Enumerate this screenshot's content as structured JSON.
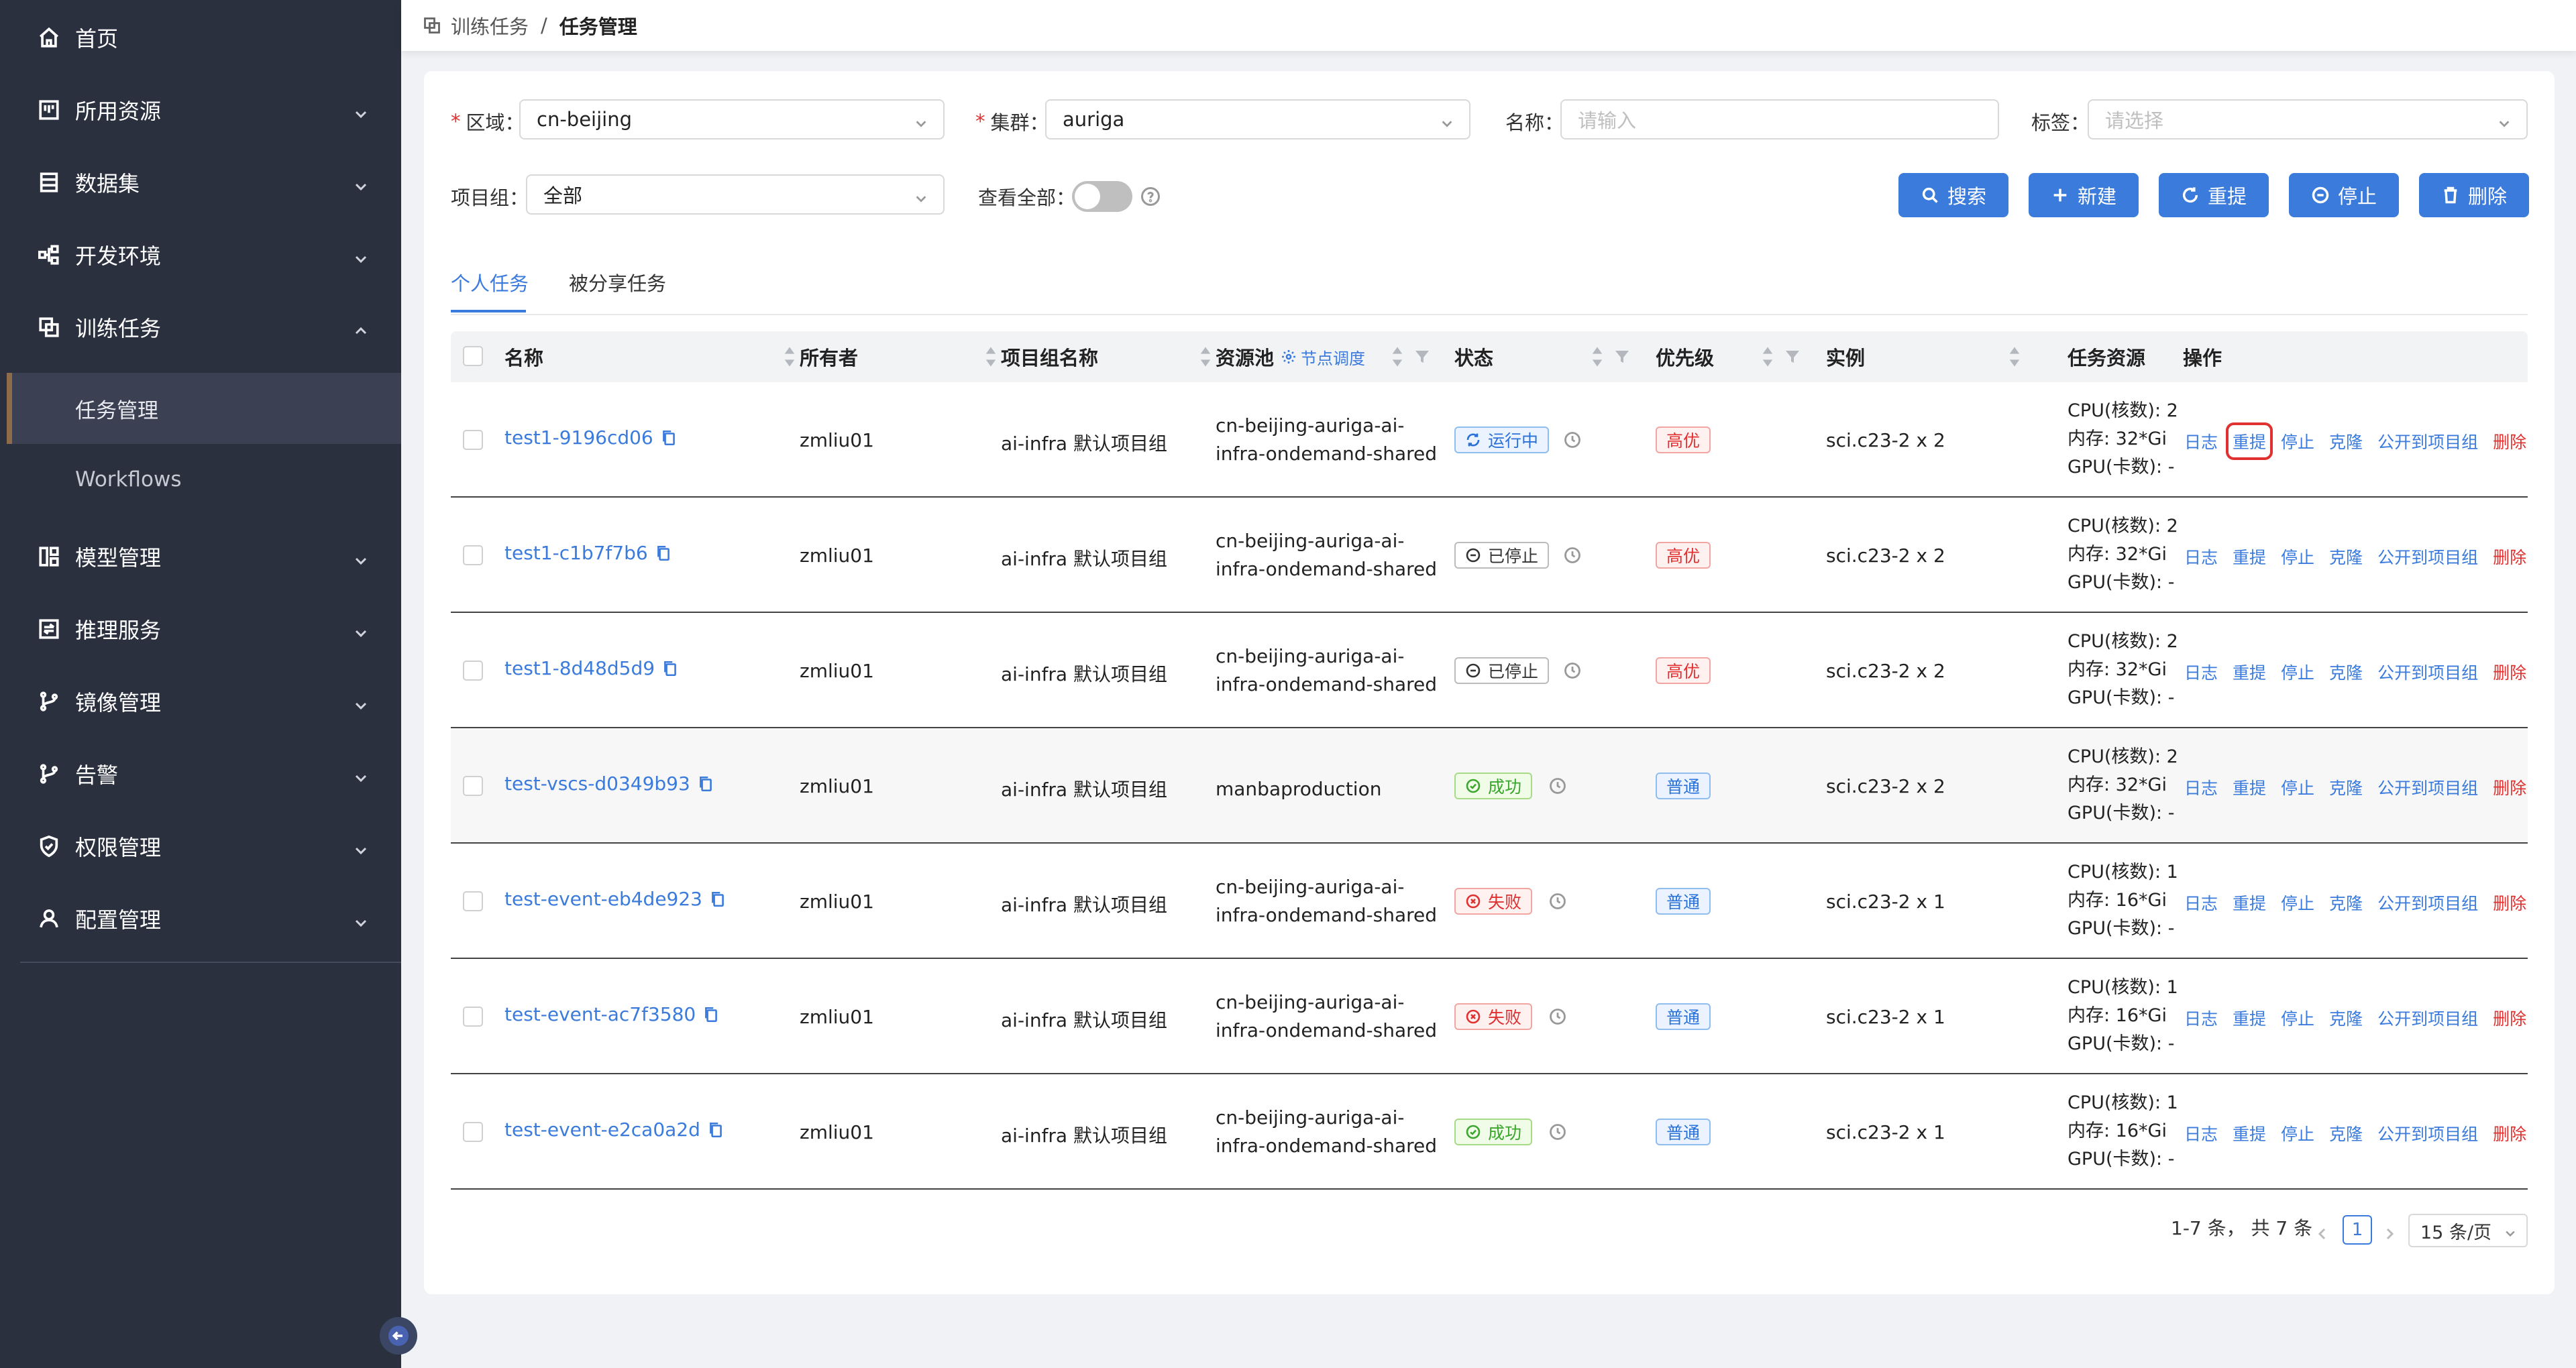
{
  "sidebar": {
    "items": [
      {
        "label": "首页",
        "icon": "home-icon"
      },
      {
        "label": "所用资源",
        "icon": "resource-icon"
      },
      {
        "label": "数据集",
        "icon": "dataset-icon"
      },
      {
        "label": "开发环境",
        "icon": "dev-env-icon"
      },
      {
        "label": "训练任务",
        "icon": "training-icon"
      },
      {
        "label": "模型管理",
        "icon": "model-icon"
      },
      {
        "label": "推理服务",
        "icon": "inference-icon"
      },
      {
        "label": "镜像管理",
        "icon": "image-icon"
      },
      {
        "label": "告警",
        "icon": "alert-icon"
      },
      {
        "label": "权限管理",
        "icon": "shield-icon"
      },
      {
        "label": "配置管理",
        "icon": "user-icon"
      }
    ],
    "submenu": [
      {
        "label": "任务管理"
      },
      {
        "label": "Workflows"
      }
    ]
  },
  "breadcrumb": {
    "parent": "训练任务",
    "sep": "/",
    "current": "任务管理"
  },
  "filters": {
    "region_label": "区域：",
    "region_value": "cn-beijing",
    "cluster_label": "集群：",
    "cluster_value": "auriga",
    "name_label": "名称：",
    "name_placeholder": "请输入",
    "tag_label": "标签：",
    "tag_placeholder": "请选择",
    "project_label": "项目组：",
    "project_value": "全部",
    "view_all_label": "查看全部："
  },
  "actions": {
    "search": "搜索",
    "new": "新建",
    "resubmit": "重提",
    "stop": "停止",
    "delete": "删除"
  },
  "tabs": [
    {
      "label": "个人任务"
    },
    {
      "label": "被分享任务"
    }
  ],
  "table": {
    "columns": {
      "name": "名称",
      "owner": "所有者",
      "project": "项目组名称",
      "pool": "资源池",
      "node_schedule": "节点调度",
      "status": "状态",
      "priority": "优先级",
      "instance": "实例",
      "resources": "任务资源",
      "ops": "操作"
    },
    "op_labels": {
      "log": "日志",
      "resubmit": "重提",
      "stop": "停止",
      "clone": "克隆",
      "publish": "公开到项目组",
      "delete": "删除"
    },
    "rows": [
      {
        "name": "test1-9196cd06",
        "owner": "zmliu01",
        "project": "ai-infra 默认项目组",
        "pool1": "cn-beijing-auriga-ai-",
        "pool2": "infra-ondemand-shared",
        "status": "运行中",
        "status_type": "running",
        "priority": "高优",
        "priority_type": "high",
        "instance": "sci.c23-2 x 2",
        "cpu": "CPU(核数): 2",
        "mem": "内存: 32*Gi",
        "gpu": "GPU(卡数): -"
      },
      {
        "name": "test1-c1b7f7b6",
        "owner": "zmliu01",
        "project": "ai-infra 默认项目组",
        "pool1": "cn-beijing-auriga-ai-",
        "pool2": "infra-ondemand-shared",
        "status": "已停止",
        "status_type": "stopped",
        "priority": "高优",
        "priority_type": "high",
        "instance": "sci.c23-2 x 2",
        "cpu": "CPU(核数): 2",
        "mem": "内存: 32*Gi",
        "gpu": "GPU(卡数): -"
      },
      {
        "name": "test1-8d48d5d9",
        "owner": "zmliu01",
        "project": "ai-infra 默认项目组",
        "pool1": "cn-beijing-auriga-ai-",
        "pool2": "infra-ondemand-shared",
        "status": "已停止",
        "status_type": "stopped",
        "priority": "高优",
        "priority_type": "high",
        "instance": "sci.c23-2 x 2",
        "cpu": "CPU(核数): 2",
        "mem": "内存: 32*Gi",
        "gpu": "GPU(卡数): -"
      },
      {
        "name": "test-vscs-d0349b93",
        "owner": "zmliu01",
        "project": "ai-infra 默认项目组",
        "pool1": "manbaproduction",
        "pool2": "",
        "status": "成功",
        "status_type": "success",
        "priority": "普通",
        "priority_type": "normal",
        "instance": "sci.c23-2 x 2",
        "cpu": "CPU(核数): 2",
        "mem": "内存: 32*Gi",
        "gpu": "GPU(卡数): -"
      },
      {
        "name": "test-event-eb4de923",
        "owner": "zmliu01",
        "project": "ai-infra 默认项目组",
        "pool1": "cn-beijing-auriga-ai-",
        "pool2": "infra-ondemand-shared",
        "status": "失败",
        "status_type": "failed",
        "priority": "普通",
        "priority_type": "normal",
        "instance": "sci.c23-2 x 1",
        "cpu": "CPU(核数): 1",
        "mem": "内存: 16*Gi",
        "gpu": "GPU(卡数): -"
      },
      {
        "name": "test-event-ac7f3580",
        "owner": "zmliu01",
        "project": "ai-infra 默认项目组",
        "pool1": "cn-beijing-auriga-ai-",
        "pool2": "infra-ondemand-shared",
        "status": "失败",
        "status_type": "failed",
        "priority": "普通",
        "priority_type": "normal",
        "instance": "sci.c23-2 x 1",
        "cpu": "CPU(核数): 1",
        "mem": "内存: 16*Gi",
        "gpu": "GPU(卡数): -"
      },
      {
        "name": "test-event-e2ca0a2d",
        "owner": "zmliu01",
        "project": "ai-infra 默认项目组",
        "pool1": "cn-beijing-auriga-ai-",
        "pool2": "infra-ondemand-shared",
        "status": "成功",
        "status_type": "success",
        "priority": "普通",
        "priority_type": "normal",
        "instance": "sci.c23-2 x 1",
        "cpu": "CPU(核数): 1",
        "mem": "内存: 16*Gi",
        "gpu": "GPU(卡数): -"
      }
    ]
  },
  "pagination": {
    "summary": "1-7 条， 共 7 条",
    "current_page": "1",
    "page_size": "15 条/页"
  },
  "colors": {
    "primary": "#3b7bdc",
    "danger": "#e0302f",
    "sidebar_bg": "#2b303f",
    "success": "#3aa62c"
  }
}
